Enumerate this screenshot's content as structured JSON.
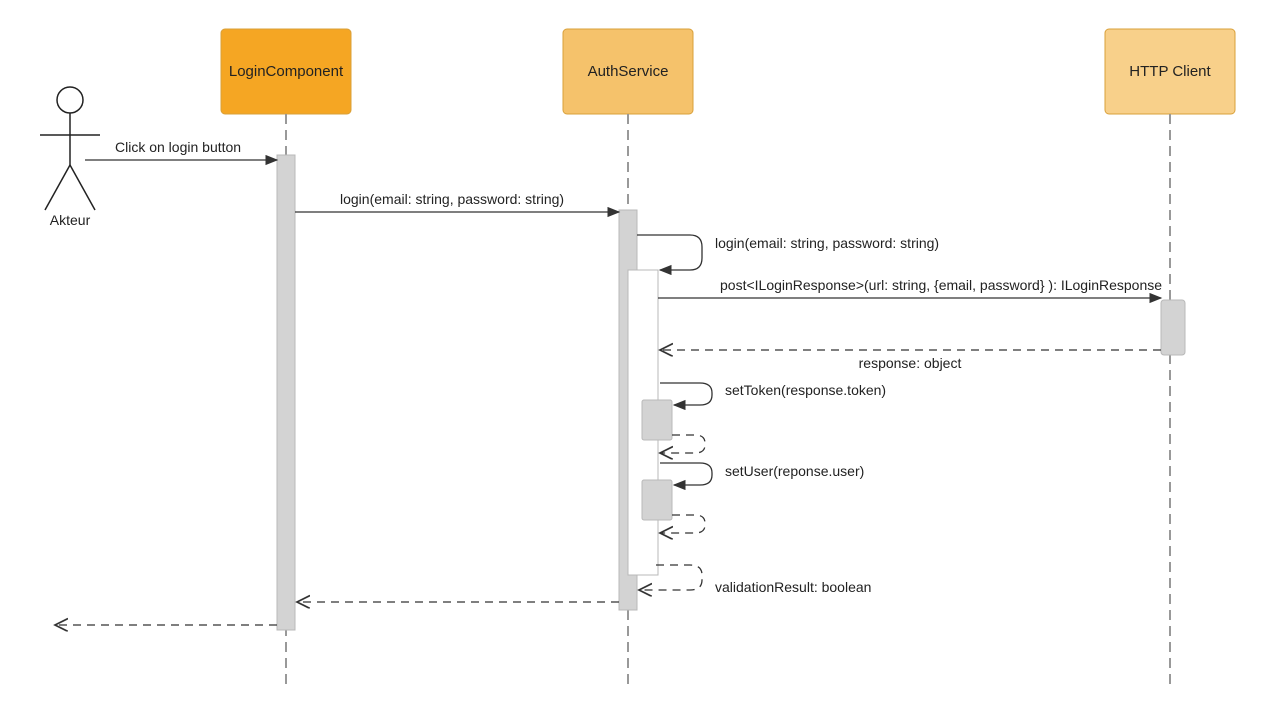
{
  "actor": {
    "name": "Akteur"
  },
  "participants": [
    {
      "id": "login",
      "label": "LoginComponent",
      "fill": "#f5a623"
    },
    {
      "id": "auth",
      "label": "AuthService",
      "fill": "#f5c26b"
    },
    {
      "id": "http",
      "label": "HTTP Client",
      "fill": "#f8d08a"
    }
  ],
  "messages": {
    "m1": "Click on login button",
    "m2": "login(email: string, password: string)",
    "m3": "login(email: string, password: string)",
    "m4": "post<ILoginResponse>(url: string, {email, password} ): ILoginResponse",
    "m5": "response: object",
    "m6": "setToken(response.token)",
    "m7": "setUser(reponse.user)",
    "m8": "validationResult: boolean"
  }
}
